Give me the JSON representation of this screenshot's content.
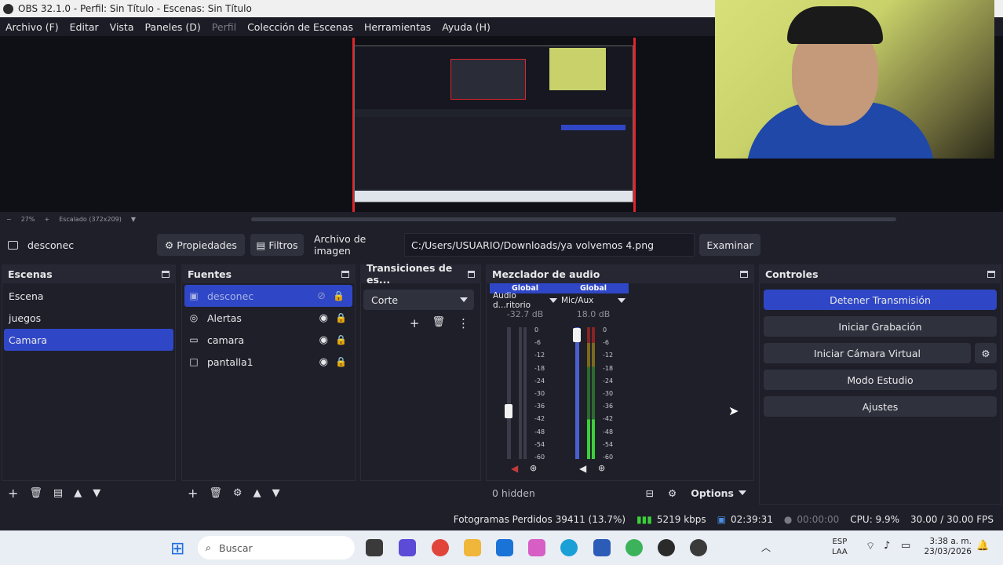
{
  "window": {
    "title": "OBS 32.1.0 - Perfil: Sin Título - Escenas: Sin Título"
  },
  "menu": [
    {
      "label": "Archivo (F)",
      "enabled": true
    },
    {
      "label": "Editar",
      "enabled": true
    },
    {
      "label": "Vista",
      "enabled": true
    },
    {
      "label": "Paneles (D)",
      "enabled": true
    },
    {
      "label": "Perfil",
      "enabled": false
    },
    {
      "label": "Colección de Escenas",
      "enabled": true
    },
    {
      "label": "Herramientas",
      "enabled": true
    },
    {
      "label": "Ayuda (H)",
      "enabled": true
    }
  ],
  "preview": {
    "zoom": "27%",
    "scale_label": "Escalado (372x209)"
  },
  "properties_bar": {
    "source_name": "desconec",
    "properties_label": "Propiedades",
    "filters_label": "Filtros",
    "file_label": "Archivo de imagen",
    "file_path": "C:/Users/USUARIO/Downloads/ya volvemos 4.png",
    "browse_label": "Examinar"
  },
  "scenes": {
    "title": "Escenas",
    "items": [
      "Escena",
      "juegos",
      "Camara"
    ],
    "selected": "Camara"
  },
  "sources": {
    "title": "Fuentes",
    "items": [
      {
        "name": "desconec",
        "icon": "image-icon",
        "visible": false
      },
      {
        "name": "Alertas",
        "icon": "browser-icon",
        "visible": true
      },
      {
        "name": "camara",
        "icon": "window-icon",
        "visible": true
      },
      {
        "name": "pantalla1",
        "icon": "monitor-icon",
        "visible": true
      }
    ]
  },
  "transitions": {
    "title": "Transiciones de es...",
    "selected": "Corte"
  },
  "mixer": {
    "title": "Mezclador de audio",
    "channels": [
      {
        "badge": "Global",
        "name": "Audio d...ritorio",
        "db": "-32.7 dB",
        "muted": true,
        "fader_level_fraction": 0.42
      },
      {
        "badge": "Global",
        "name": "Mic/Aux",
        "db": "18.0 dB",
        "muted": false,
        "fader_level_fraction": 0.97
      }
    ],
    "scale": [
      "0",
      "-6",
      "-12",
      "-18",
      "-24",
      "-30",
      "-36",
      "-42",
      "-48",
      "-54",
      "-60"
    ],
    "hidden_label": "0 hidden",
    "options_label": "Options"
  },
  "controls": {
    "title": "Controles",
    "stop_stream": "Detener Transmisión",
    "start_record": "Iniciar Grabación",
    "virtual_cam": "Iniciar Cámara Virtual",
    "studio_mode": "Modo Estudio",
    "settings": "Ajustes"
  },
  "status": {
    "dropped_frames": "Fotogramas Perdidos 39411 (13.7%)",
    "bitrate": "5219 kbps",
    "stream_time": "02:39:31",
    "record_time": "00:00:00",
    "cpu": "CPU: 9.9%",
    "fps": "30.00 / 30.00 FPS"
  },
  "taskbar": {
    "search_placeholder": "Buscar",
    "lang_top": "ESP",
    "lang_bottom": "LAA",
    "time": "3:38 a. m.",
    "date": "23/03/2026"
  },
  "colors": {
    "accent": "#2f47c6",
    "panel": "#1e1f29",
    "header": "#262733",
    "red": "#e0262b"
  }
}
